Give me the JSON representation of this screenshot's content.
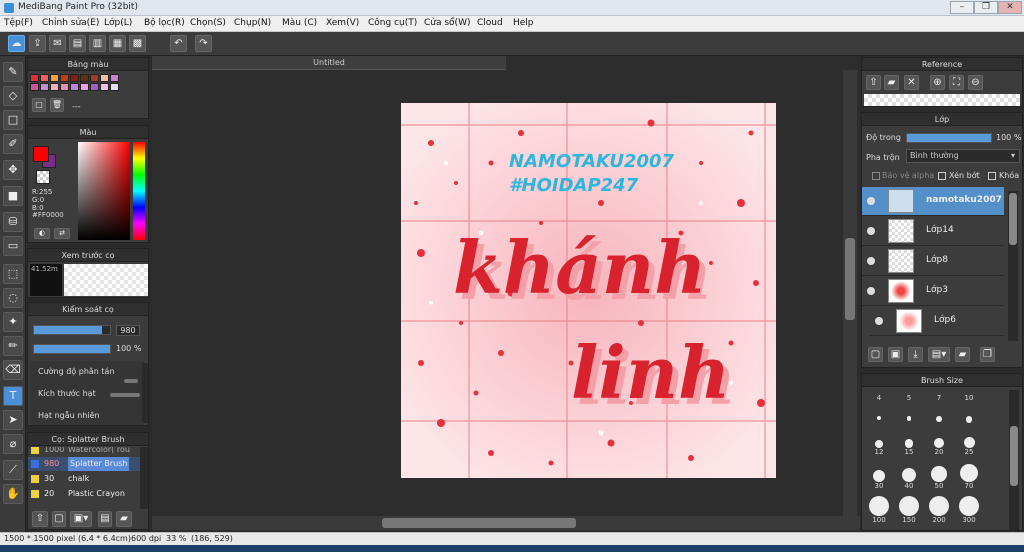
{
  "window": {
    "title": "MediBang Paint Pro (32bit)"
  },
  "menu": [
    "Tệp(F)",
    "Chỉnh sửa(E)",
    "Lớp(L)",
    "Bộ lọc(R)",
    "Chọn(S)",
    "Chụp(N)",
    "Màu (C)",
    "Xem(V)",
    "Công cụ(T)",
    "Cửa sổ(W)",
    "Cloud",
    "Help"
  ],
  "palette": {
    "title": "Bảng màu",
    "name": "---"
  },
  "color": {
    "title": "Màu",
    "r": "R:255",
    "g": "G:0",
    "b": "B:0",
    "hex": "#FF0000",
    "main": "#FF0000",
    "sub": "#7a2d8a"
  },
  "preview": {
    "title": "Xem trước cọ",
    "text": "41.52m"
  },
  "brushctrl": {
    "title": "Kiểm soát cọ",
    "size": "980",
    "opacity": "100 %",
    "size_level": 0.9,
    "opacity_level": 1.0,
    "opt1": "Cường độ phân tán",
    "opt2": "Kích thước hạt",
    "opt3": "Hạt ngẫu nhiên"
  },
  "brushes": {
    "title": "Cọ: Splatter Brush",
    "items": [
      {
        "size": "1000",
        "name": "Watercolor( rou",
        "color": "#f0d040"
      },
      {
        "size": "980",
        "name": "Splatter Brush",
        "color": "#3a6fd8"
      },
      {
        "size": "30",
        "name": "chalk",
        "color": "#f0d040"
      },
      {
        "size": "20",
        "name": "Plastic Crayon",
        "color": "#f0d040"
      }
    ]
  },
  "doc": {
    "tab": "Untitled",
    "line1": "NAMOTAKU2007",
    "line2": "#HOIDAP247",
    "word1": "khánh",
    "word2": "linh"
  },
  "reference": {
    "title": "Reference"
  },
  "layers": {
    "title": "Lớp",
    "opacity_label": "Độ trong",
    "opacity": "100 %",
    "blend_label": "Pha trộn",
    "blend": "Bình thường",
    "protect": "Bảo vệ alpha",
    "clip": "Xén bớt",
    "lock": "Khóa",
    "items": [
      {
        "name": "namotaku2007",
        "sel": true
      },
      {
        "name": "Lớp14",
        "sel": false
      },
      {
        "name": "Lớp8",
        "sel": false
      },
      {
        "name": "Lớp3",
        "sel": false
      },
      {
        "name": "Lớp6",
        "sel": false
      }
    ]
  },
  "brushsize": {
    "title": "Brush Size",
    "sizes": [
      "4",
      "5",
      "7",
      "10",
      "12",
      "15",
      "20",
      "25",
      "30",
      "40",
      "50",
      "70",
      "100",
      "150",
      "200",
      "300"
    ]
  },
  "status": {
    "pixels": "1500 * 1500 pixel",
    "cm": "(6.4 * 6.4cm)",
    "dpi": "600 dpi",
    "zoom": "33 %",
    "coords": "(186, 529)"
  }
}
